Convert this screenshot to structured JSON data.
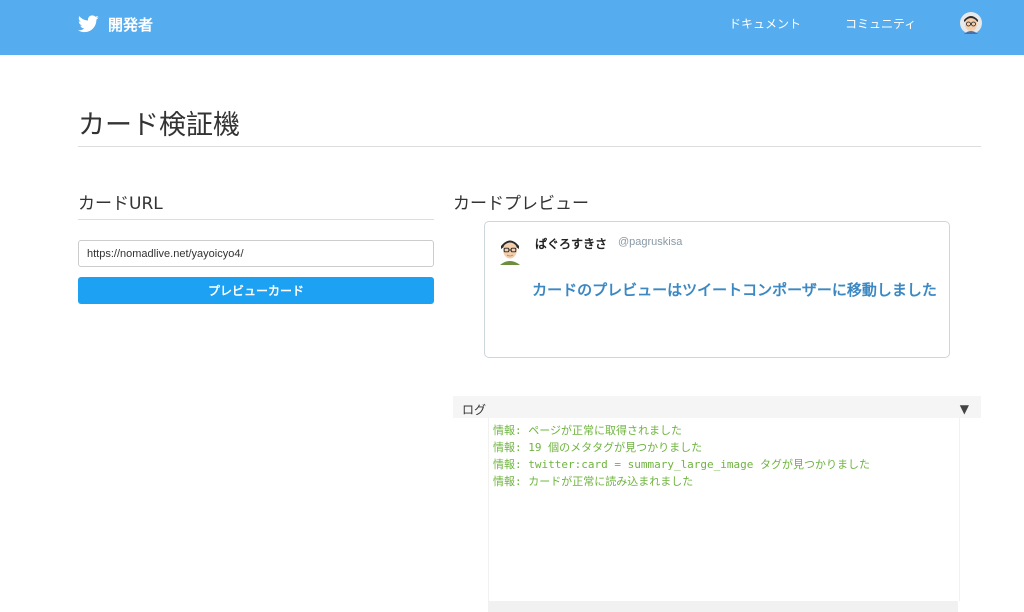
{
  "header": {
    "brand_label": "開発者",
    "nav": [
      {
        "label": "ドキュメント"
      },
      {
        "label": "コミュニティ"
      }
    ],
    "colors": {
      "bar": "#55acee"
    }
  },
  "page": {
    "title": "カード検証機"
  },
  "url_section": {
    "title": "カードURL",
    "input_value": "https://nomadlive.net/yayoicyo4/",
    "button_label": "プレビューカード"
  },
  "preview": {
    "title": "カードプレビュー",
    "user_name": "ぱぐろすきさ",
    "user_handle": "@pagruskisa",
    "message": "カードのプレビューはツイートコンポーザーに移動しました"
  },
  "log": {
    "label": "ログ",
    "toggle_icon": "triangle-down-icon",
    "lines": [
      "情報: ページが正常に取得されました",
      "情報: 19 個のメタタグが見つかりました",
      "情報: twitter:card = summary_large_image タグが見つかりました",
      "情報: カードが正常に読み込まれました"
    ]
  }
}
